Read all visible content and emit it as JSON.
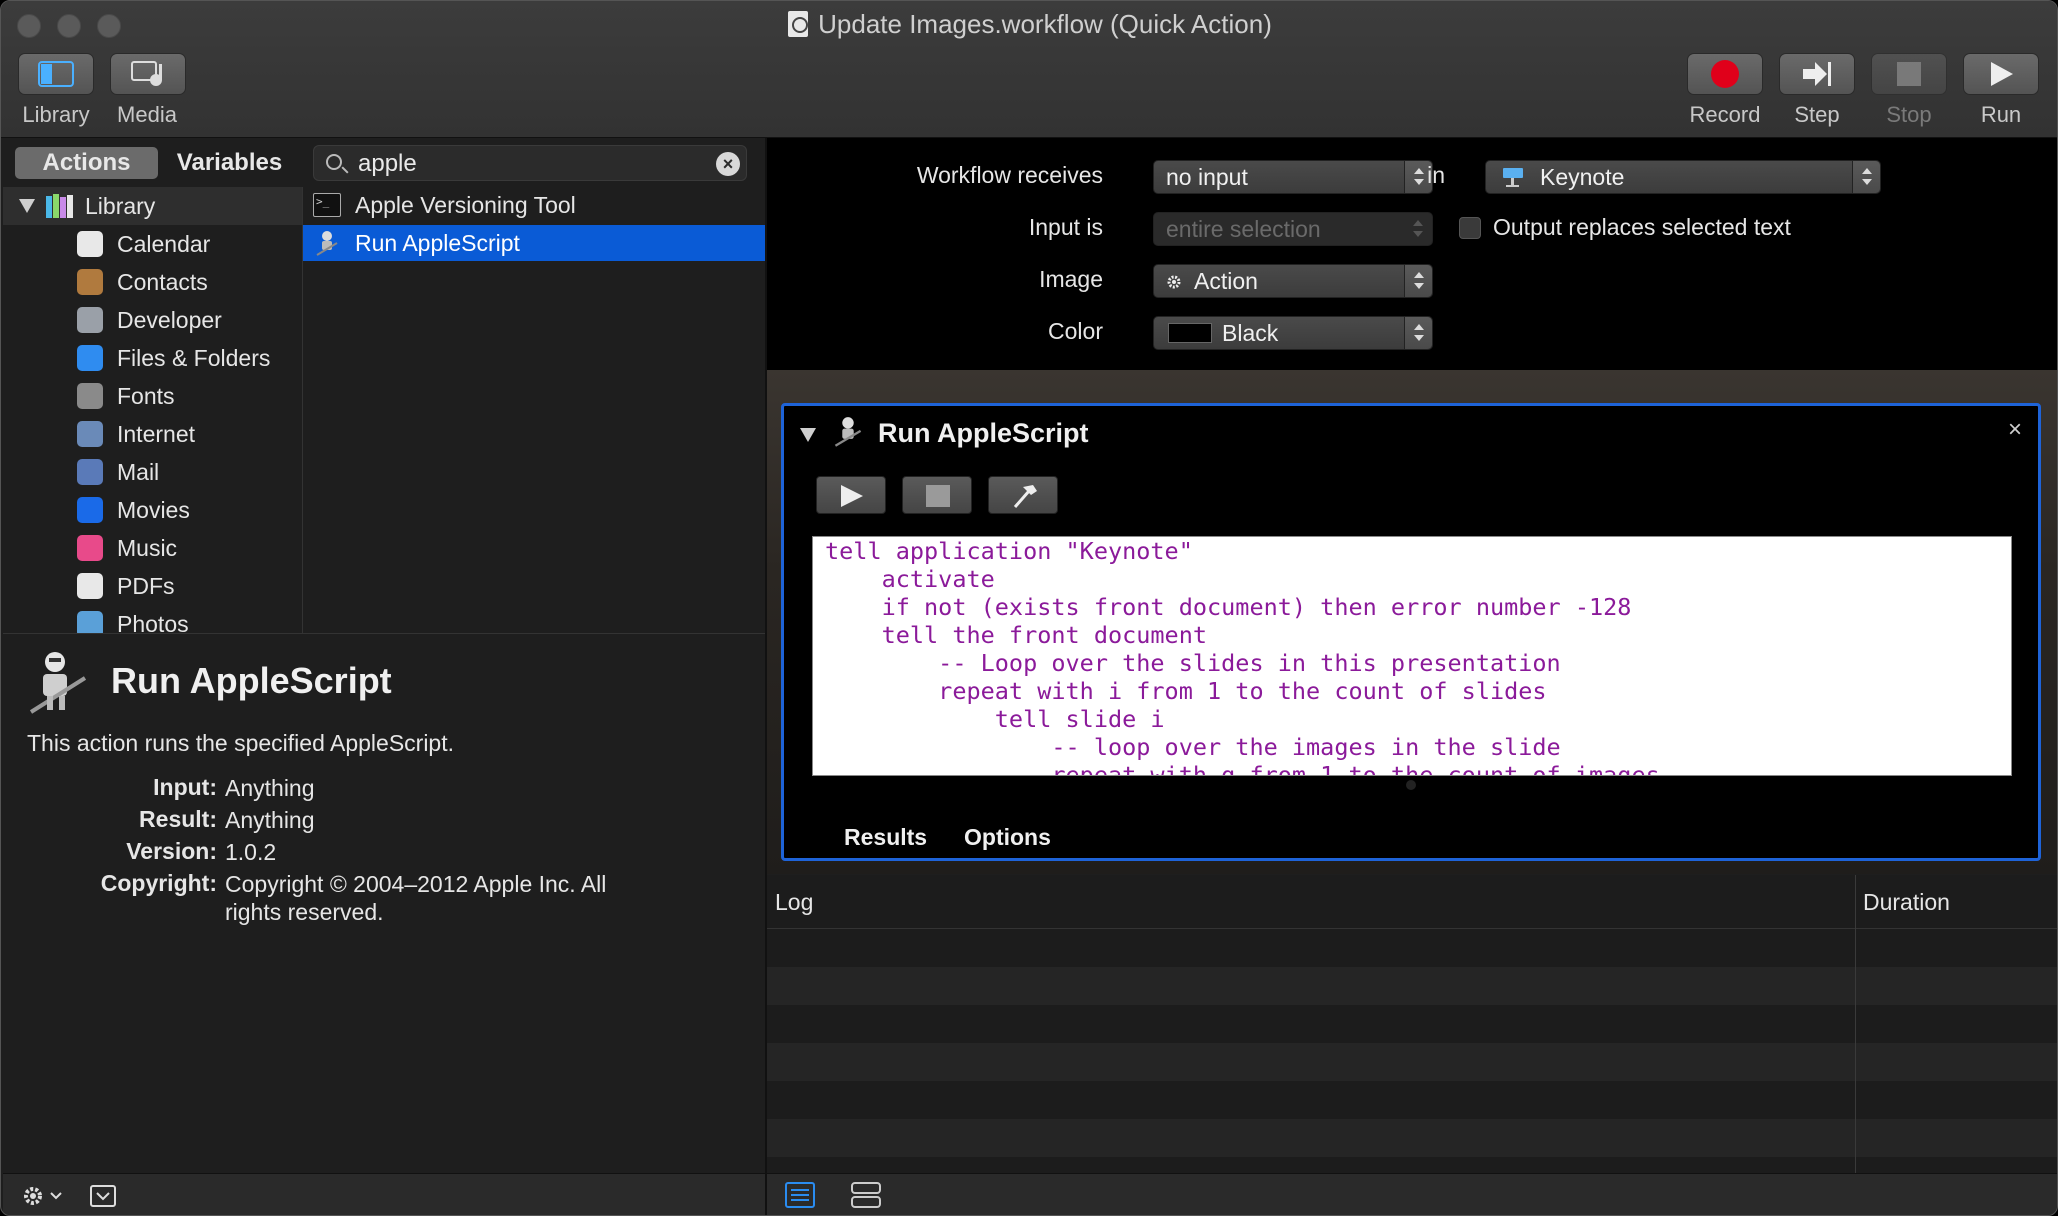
{
  "window": {
    "title": "Update Images.workflow (Quick Action)"
  },
  "toolbar": {
    "library_label": "Library",
    "media_label": "Media",
    "record_label": "Record",
    "step_label": "Step",
    "stop_label": "Stop",
    "run_label": "Run"
  },
  "left": {
    "tabs": {
      "actions": "Actions",
      "variables": "Variables"
    },
    "search": {
      "value": "apple",
      "clear_glyph": "×"
    },
    "library_root": "Library",
    "library_items": [
      {
        "label": "Calendar",
        "icon": "calendar-icon",
        "color": "#e8e8e8"
      },
      {
        "label": "Contacts",
        "icon": "contacts-icon",
        "color": "#b07a3e"
      },
      {
        "label": "Developer",
        "icon": "developer-icon",
        "color": "#9aa0a8"
      },
      {
        "label": "Files & Folders",
        "icon": "finder-icon",
        "color": "#2f8cf0"
      },
      {
        "label": "Fonts",
        "icon": "fonts-icon",
        "color": "#8a8a8a"
      },
      {
        "label": "Internet",
        "icon": "globe-icon",
        "color": "#6a8ab8"
      },
      {
        "label": "Mail",
        "icon": "mail-icon",
        "color": "#5a7ab8"
      },
      {
        "label": "Movies",
        "icon": "movies-icon",
        "color": "#1a6ae8"
      },
      {
        "label": "Music",
        "icon": "music-icon",
        "color": "#e84a8a"
      },
      {
        "label": "PDFs",
        "icon": "pdf-icon",
        "color": "#e8e8e8"
      },
      {
        "label": "Photos",
        "icon": "photos-icon",
        "color": "#5aa0d8"
      }
    ],
    "actions": [
      {
        "label": "Apple Versioning Tool",
        "selected": false
      },
      {
        "label": "Run AppleScript",
        "selected": true
      }
    ],
    "info": {
      "title": "Run AppleScript",
      "description": "This action runs the specified AppleScript.",
      "input_key": "Input:",
      "input_val": "Anything",
      "result_key": "Result:",
      "result_val": "Anything",
      "version_key": "Version:",
      "version_val": "1.0.2",
      "copyright_key": "Copyright:",
      "copyright_val": "Copyright © 2004–2012 Apple Inc.  All rights reserved."
    }
  },
  "workflow": {
    "receives_label": "Workflow receives",
    "receives_value": "no input",
    "in_label": "in",
    "app_value": "Keynote",
    "input_is_label": "Input is",
    "input_is_value": "entire selection",
    "output_replaces_label": "Output replaces selected text",
    "output_replaces_checked": false,
    "image_label": "Image",
    "image_value": "Action",
    "color_label": "Color",
    "color_value": "Black",
    "color_swatch": "#000000"
  },
  "action": {
    "title": "Run AppleScript",
    "close_glyph": "×",
    "code": "tell application \"Keynote\"\n    activate\n    if not (exists front document) then error number -128\n    tell the front document\n        -- Loop over the slides in this presentation\n        repeat with i from 1 to the count of slides\n            tell slide i\n                -- loop over the images in the slide\n                repeat with g from 1 to the count of images",
    "results_tab": "Results",
    "options_tab": "Options"
  },
  "log": {
    "col_log": "Log",
    "col_duration": "Duration"
  },
  "colors": {
    "selection": "#0a5bd6",
    "action_border": "#1e63d8",
    "code_text": "#8b1a9a",
    "record_red": "#e0001a"
  }
}
